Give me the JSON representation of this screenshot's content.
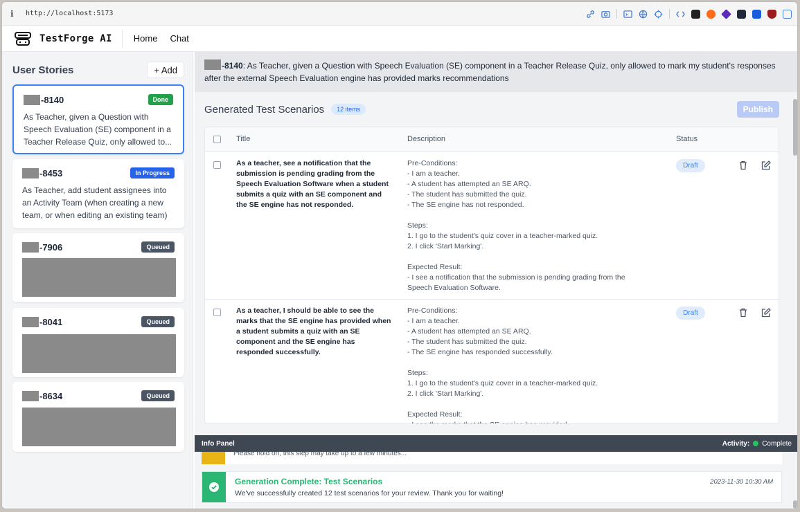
{
  "browser": {
    "url": "http://localhost:5173"
  },
  "app": {
    "brand": "TestForge AI",
    "nav": [
      "Home",
      "Chat"
    ]
  },
  "sidebar": {
    "title": "User Stories",
    "add_label": "+ Add",
    "stories": [
      {
        "id": "-8140",
        "status": "Done",
        "text": "As Teacher, given a Question with Speech Evaluation (SE) component in a Teacher Release Quiz, only allowed to..."
      },
      {
        "id": "-8453",
        "status": "In Progress",
        "text": "As Teacher, add student assignees into an Activity Team (when creating a new team, or when editing an existing team)"
      },
      {
        "id": "-7906",
        "status": "Queued",
        "text": ""
      },
      {
        "id": "-8041",
        "status": "Queued",
        "text": ""
      },
      {
        "id": "-8634",
        "status": "Queued",
        "text": ""
      }
    ]
  },
  "main": {
    "story_id": "-8140",
    "story_text": ": As Teacher, given a Question with Speech Evaluation (SE) component in a Teacher Release Quiz, only allowed to mark my student's responses after the external Speech Evaluation engine has provided marks recommendations",
    "scenarios_title": "Generated Test Scenarios",
    "count_label": "12 items",
    "publish_label": "Publish",
    "columns": [
      "Title",
      "Description",
      "Status"
    ],
    "rows": [
      {
        "title": "As a teacher, see a notification that the submission is pending grading from the Speech Evaluation Software when a student submits a quiz with an SE component and the SE engine has not responded.",
        "description": "Pre-Conditions:\n- I am a teacher.\n- A student has attempted an SE ARQ.\n- The student has submitted the quiz.\n- The SE engine has not responded.\n\nSteps:\n1. I go to the student's quiz cover in a teacher-marked quiz.\n2. I click 'Start Marking'.\n\nExpected Result:\n- I see a notification that the submission is pending grading from the Speech Evaluation Software.",
        "status": "Draft"
      },
      {
        "title": "As a teacher, I should be able to see the marks that the SE engine has provided when a student submits a quiz with an SE component and the SE engine has responded successfully.",
        "description": "Pre-Conditions:\n- I am a teacher.\n- A student has attempted an SE ARQ.\n- The student has submitted the quiz.\n- The SE engine has responded successfully.\n\nSteps:\n1. I go to the student's quiz cover in a teacher-marked quiz.\n2. I click 'Start Marking'.\n\nExpected Result:\n- I see the marks that the SE engine has provided",
        "status": "Draft"
      }
    ]
  },
  "info_panel": {
    "title": "Info Panel",
    "activity_label": "Activity:",
    "activity_status": "Complete",
    "partial_message": "Please hold on, this step may take up to a few minutes...",
    "message_title": "Generation Complete: Test Scenarios",
    "message_body": "We've successfully created 12 test scenarios for your review. Thank you for waiting!",
    "message_time": "2023-11-30 10:30 AM"
  },
  "colors": {
    "accent": "#3b82f6",
    "done": "#22a04b",
    "in_progress": "#2563eb",
    "queued": "#4b5563",
    "success": "#2bb673",
    "warning": "#e8b416"
  },
  "icons": [
    "info-icon",
    "link-icon",
    "camera-icon",
    "terminal-icon",
    "globe-icon",
    "crosshair-icon",
    "trash-icon",
    "edit-icon",
    "check-circle-icon"
  ]
}
